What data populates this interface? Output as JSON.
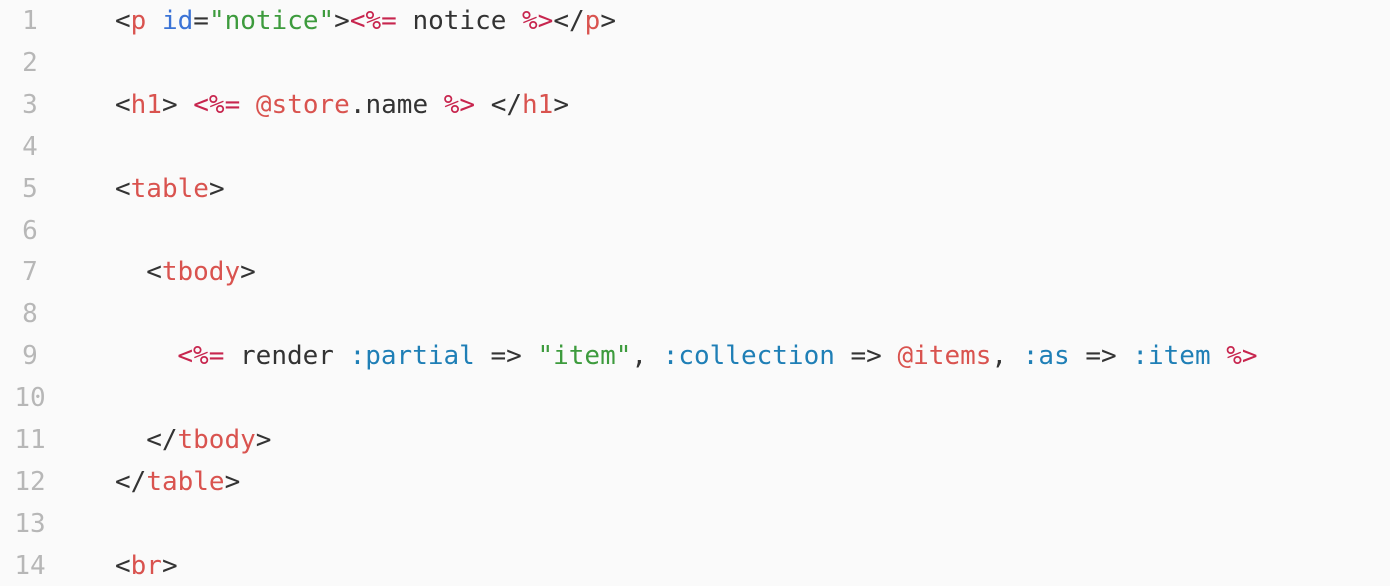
{
  "editor": {
    "lines": [
      {
        "num": "1",
        "indent": 0,
        "tokens": [
          {
            "t": "<",
            "c": "plain"
          },
          {
            "t": "p",
            "c": "tag"
          },
          {
            "t": " ",
            "c": "plain"
          },
          {
            "t": "id",
            "c": "attr"
          },
          {
            "t": "=",
            "c": "plain"
          },
          {
            "t": "\"notice\"",
            "c": "str"
          },
          {
            "t": ">",
            "c": "plain"
          },
          {
            "t": "<%=",
            "c": "erb"
          },
          {
            "t": " notice ",
            "c": "plain"
          },
          {
            "t": "%>",
            "c": "erb"
          },
          {
            "t": "</",
            "c": "plain"
          },
          {
            "t": "p",
            "c": "tag"
          },
          {
            "t": ">",
            "c": "plain"
          }
        ]
      },
      {
        "num": "2",
        "indent": 0,
        "tokens": []
      },
      {
        "num": "3",
        "indent": 0,
        "tokens": [
          {
            "t": "<",
            "c": "plain"
          },
          {
            "t": "h1",
            "c": "tag"
          },
          {
            "t": "> ",
            "c": "plain"
          },
          {
            "t": "<%=",
            "c": "erb"
          },
          {
            "t": " ",
            "c": "plain"
          },
          {
            "t": "@store",
            "c": "ivar"
          },
          {
            "t": ".name ",
            "c": "plain"
          },
          {
            "t": "%>",
            "c": "erb"
          },
          {
            "t": " </",
            "c": "plain"
          },
          {
            "t": "h1",
            "c": "tag"
          },
          {
            "t": ">",
            "c": "plain"
          }
        ]
      },
      {
        "num": "4",
        "indent": 0,
        "tokens": []
      },
      {
        "num": "5",
        "indent": 0,
        "tokens": [
          {
            "t": "<",
            "c": "plain"
          },
          {
            "t": "table",
            "c": "tag"
          },
          {
            "t": ">",
            "c": "plain"
          }
        ]
      },
      {
        "num": "6",
        "indent": 0,
        "tokens": []
      },
      {
        "num": "7",
        "indent": 2,
        "tokens": [
          {
            "t": "<",
            "c": "plain"
          },
          {
            "t": "tbody",
            "c": "tag"
          },
          {
            "t": ">",
            "c": "plain"
          }
        ]
      },
      {
        "num": "8",
        "indent": 0,
        "tokens": []
      },
      {
        "num": "9",
        "indent": 4,
        "tokens": [
          {
            "t": "<%=",
            "c": "erb"
          },
          {
            "t": " render ",
            "c": "plain"
          },
          {
            "t": ":partial",
            "c": "sym"
          },
          {
            "t": " => ",
            "c": "plain"
          },
          {
            "t": "\"item\"",
            "c": "str"
          },
          {
            "t": ", ",
            "c": "plain"
          },
          {
            "t": ":collection",
            "c": "sym"
          },
          {
            "t": " => ",
            "c": "plain"
          },
          {
            "t": "@items",
            "c": "ivar"
          },
          {
            "t": ", ",
            "c": "plain"
          },
          {
            "t": ":as",
            "c": "sym"
          },
          {
            "t": " => ",
            "c": "plain"
          },
          {
            "t": ":item",
            "c": "sym"
          },
          {
            "t": " ",
            "c": "plain"
          },
          {
            "t": "%>",
            "c": "erb"
          }
        ]
      },
      {
        "num": "10",
        "indent": 0,
        "tokens": []
      },
      {
        "num": "11",
        "indent": 2,
        "tokens": [
          {
            "t": "</",
            "c": "plain"
          },
          {
            "t": "tbody",
            "c": "tag"
          },
          {
            "t": ">",
            "c": "plain"
          }
        ]
      },
      {
        "num": "12",
        "indent": 0,
        "tokens": [
          {
            "t": "</",
            "c": "plain"
          },
          {
            "t": "table",
            "c": "tag"
          },
          {
            "t": ">",
            "c": "plain"
          }
        ]
      },
      {
        "num": "13",
        "indent": 0,
        "tokens": []
      },
      {
        "num": "14",
        "indent": 0,
        "tokens": [
          {
            "t": "<",
            "c": "plain"
          },
          {
            "t": "br",
            "c": "tag"
          },
          {
            "t": ">",
            "c": "plain"
          }
        ]
      }
    ]
  },
  "colors": {
    "background": "#fafafa",
    "gutter_text": "#b7b7b7",
    "plain": "#333333",
    "tag": "#d9534f",
    "erb": "#c7254e",
    "attribute": "#3b73d6",
    "string": "#3d9b3d",
    "symbol": "#1f7fb6",
    "instance_variable": "#d9534f"
  }
}
